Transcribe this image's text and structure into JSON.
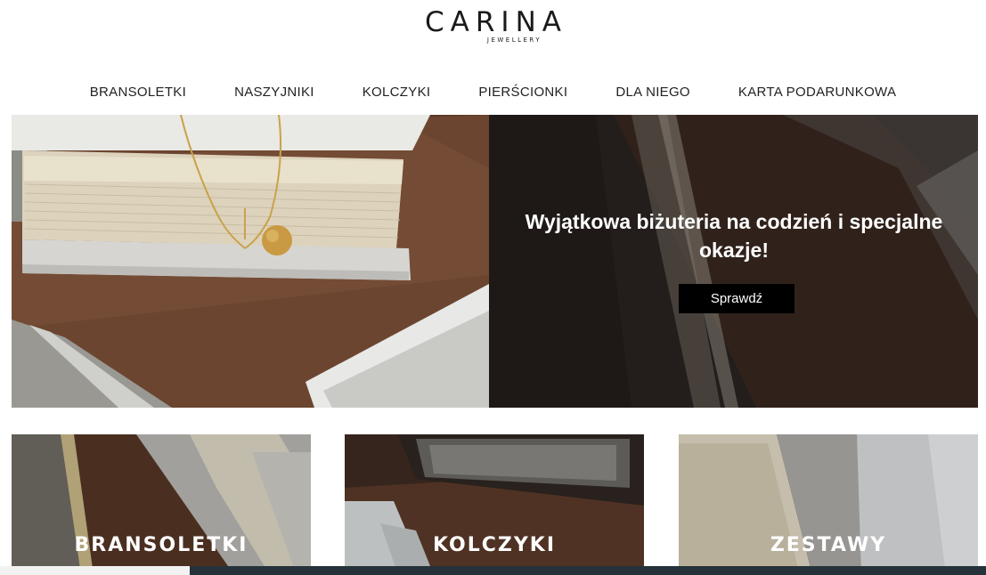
{
  "brand": {
    "name": "CARINA",
    "tagline": "JEWELLERY"
  },
  "nav": {
    "items": [
      {
        "label": "BRANSOLETKI"
      },
      {
        "label": "NASZYJNIKI"
      },
      {
        "label": "KOLCZYKI"
      },
      {
        "label": "PIERŚCIONKI"
      },
      {
        "label": "DLA NIEGO"
      },
      {
        "label": "KARTA PODARUNKOWA"
      }
    ]
  },
  "hero": {
    "title": "Wyjątkowa biżuteria na codzień i specjalne okazje!",
    "button_label": "Sprawdź"
  },
  "tiles": [
    {
      "label": "BRANSOLETKI"
    },
    {
      "label": "KOLCZYKI"
    },
    {
      "label": "ZESTAWY"
    }
  ],
  "colors": {
    "wood": "#5a3a28",
    "dark": "#2b2522",
    "button": "#000000",
    "text": "#222222"
  }
}
